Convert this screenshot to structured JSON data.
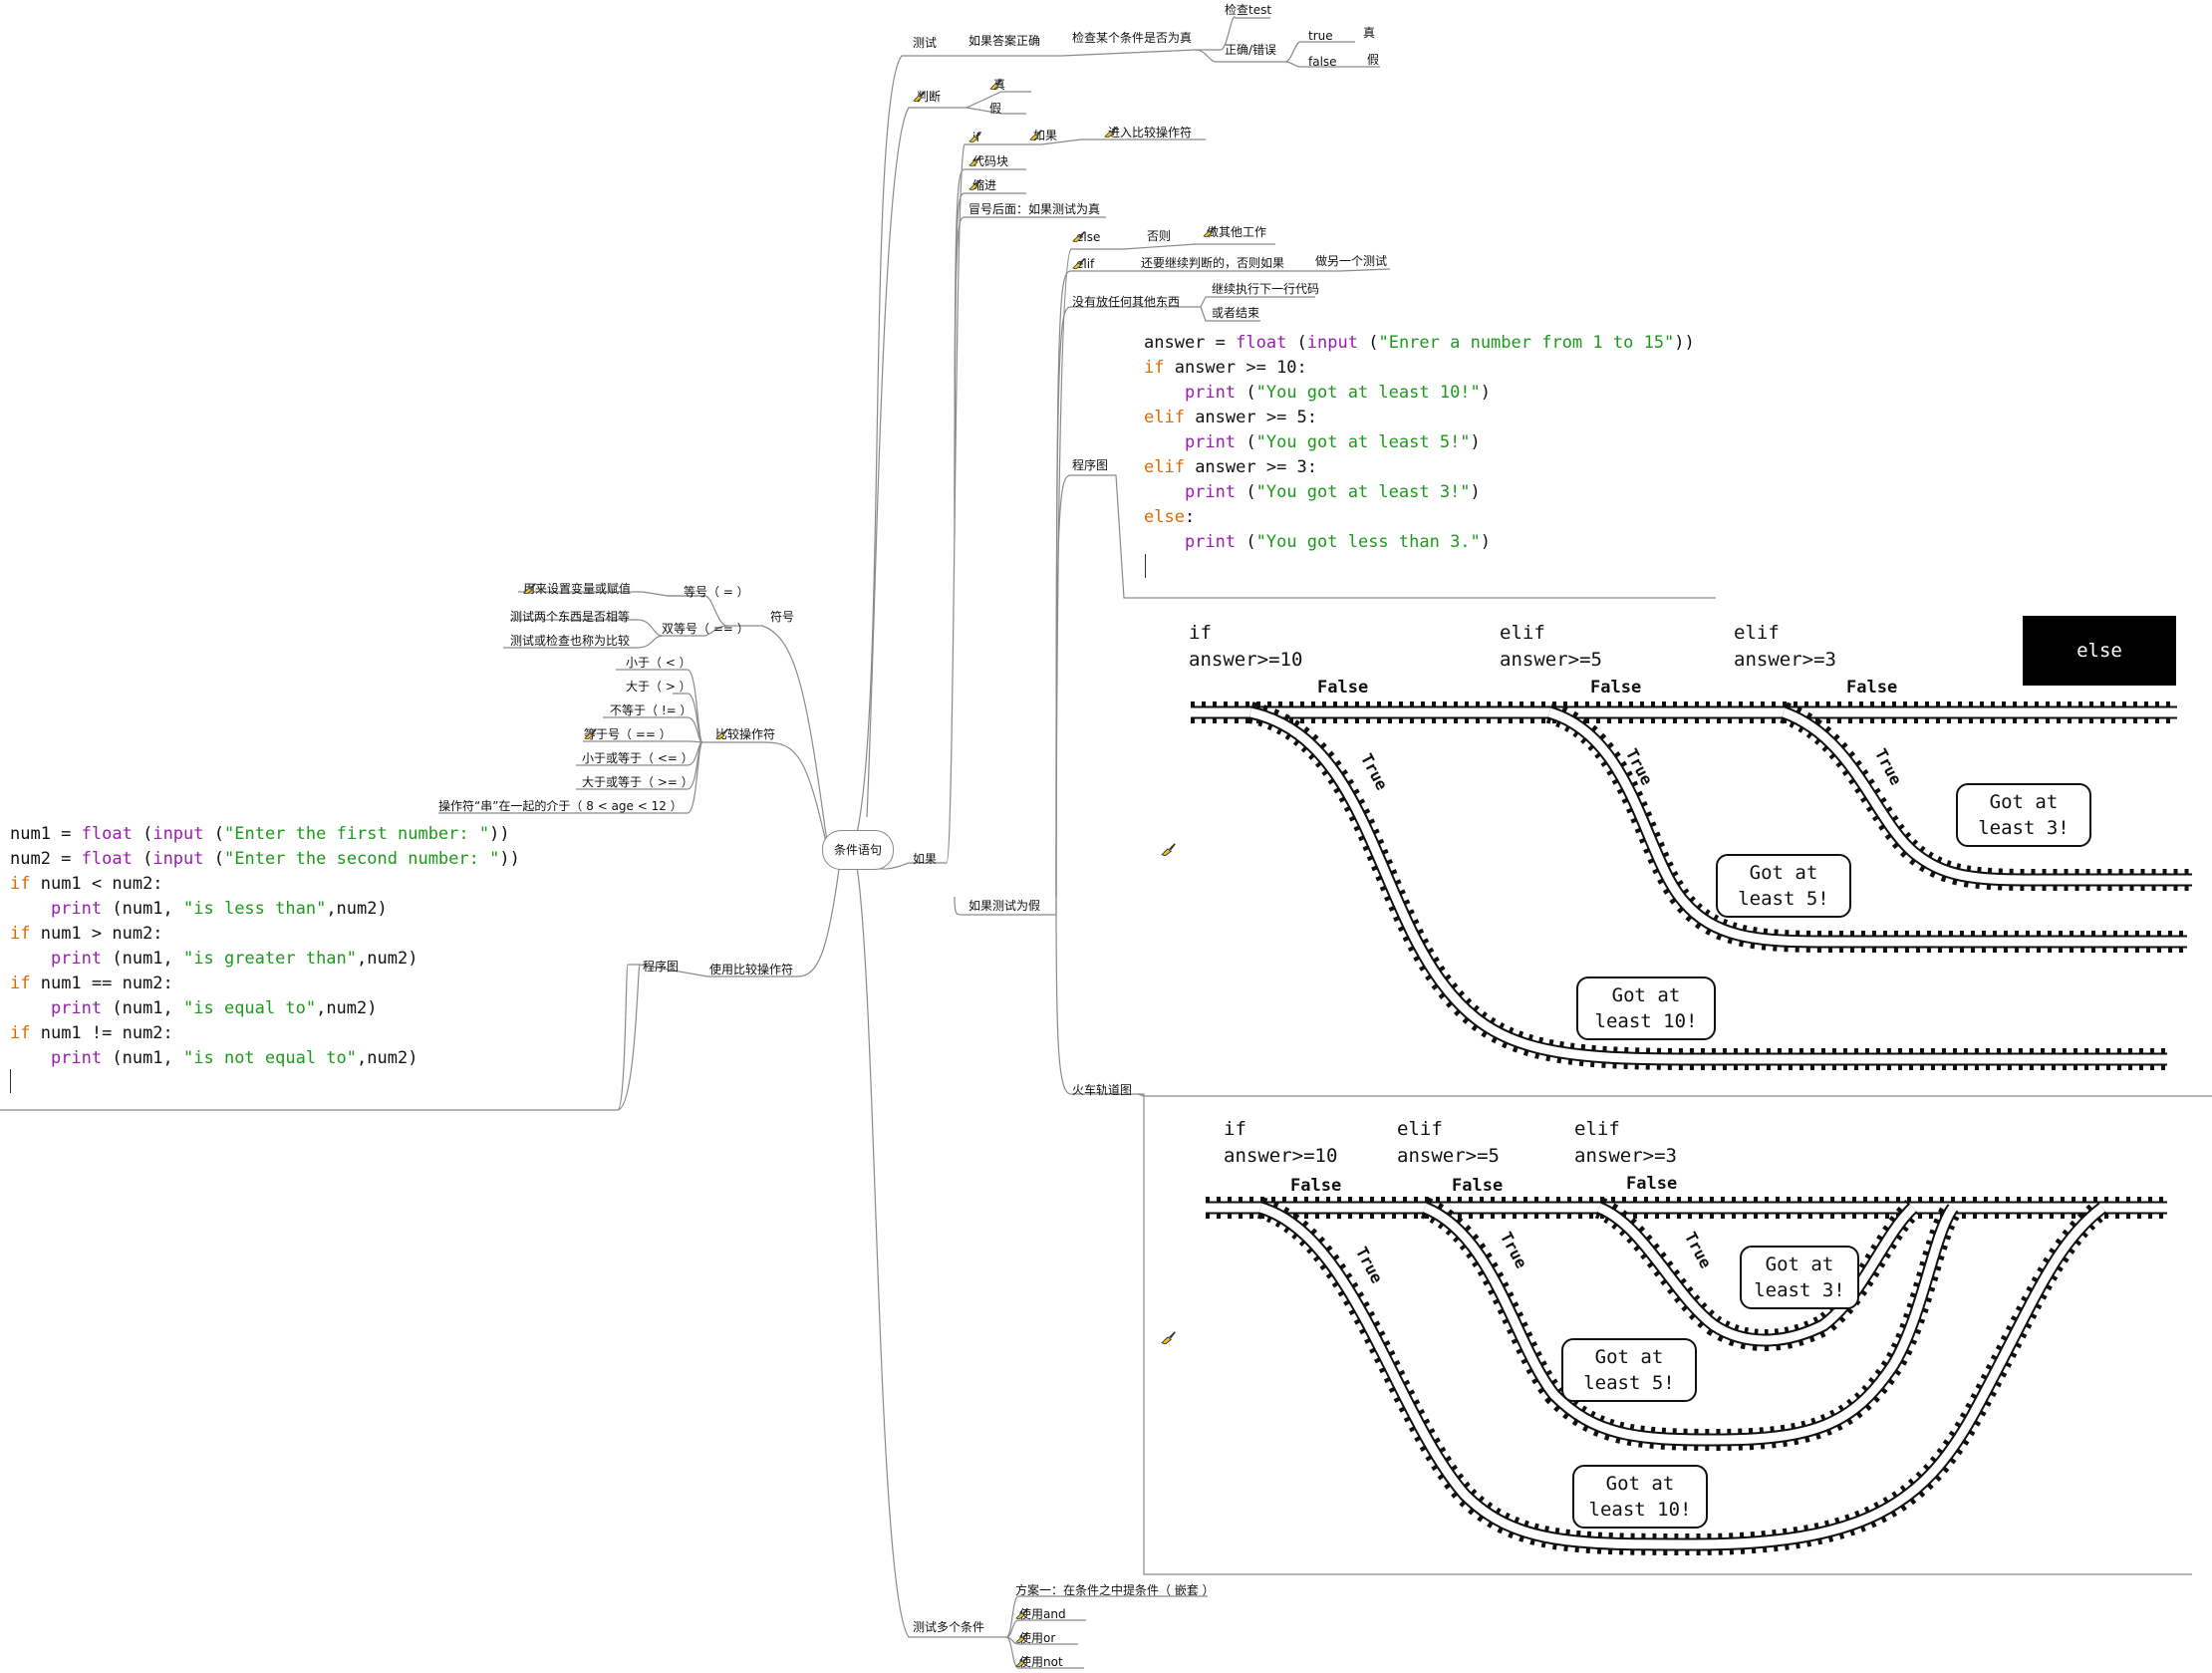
{
  "root": "条件语句",
  "test_branch": {
    "label": "测试",
    "if_correct": "如果答案正确",
    "check_condition": "检查某个条件是否为真",
    "check_test": "检查test",
    "correct_wrong": "正确/错误",
    "true_label": "true",
    "true_value": "真",
    "false_label": "false",
    "false_value": "假"
  },
  "judge_branch": {
    "label": "判断",
    "true": "真",
    "false": "假"
  },
  "if_branch": {
    "label": "如果",
    "if_kw": "if",
    "if_meaning": "如果",
    "enter_compare": "进入比较操作符",
    "code_block": "代码块",
    "indent": "缩进",
    "after_colon": "冒号后面：如果测试为真",
    "if_false": "如果测试为假",
    "else_kw": "else",
    "else_meaning": "否则",
    "do_other": "做其他工作",
    "elif_kw": "elif",
    "elif_meaning": "还要继续判断的，否则如果",
    "do_another_test": "做另一个测试",
    "nothing_else": "没有放任何其他东西",
    "continue_next": "继续执行下一行代码",
    "or_end": "或者结束",
    "flow_chart": "程序图",
    "train_track": "火车轨道图"
  },
  "code_answer": [
    [
      {
        "t": "answer = ",
        "c": ""
      },
      {
        "t": "float",
        "c": "f"
      },
      {
        "t": " (",
        "c": ""
      },
      {
        "t": "input",
        "c": "f"
      },
      {
        "t": " (",
        "c": ""
      },
      {
        "t": "\"Enrer a number from 1 to 15\"",
        "c": "s"
      },
      {
        "t": "))",
        "c": ""
      }
    ],
    [
      {
        "t": "if",
        "c": "k"
      },
      {
        "t": " answer >= 10:",
        "c": ""
      }
    ],
    [
      {
        "t": "    print",
        "c": "f"
      },
      {
        "t": " (",
        "c": ""
      },
      {
        "t": "\"You got at least 10!\"",
        "c": "s"
      },
      {
        "t": ")",
        "c": ""
      }
    ],
    [
      {
        "t": "elif",
        "c": "k"
      },
      {
        "t": " answer >= 5:",
        "c": ""
      }
    ],
    [
      {
        "t": "    print",
        "c": "f"
      },
      {
        "t": " (",
        "c": ""
      },
      {
        "t": "\"You got at least 5!\"",
        "c": "s"
      },
      {
        "t": ")",
        "c": ""
      }
    ],
    [
      {
        "t": "elif",
        "c": "k"
      },
      {
        "t": " answer >= 3:",
        "c": ""
      }
    ],
    [
      {
        "t": "    print",
        "c": "f"
      },
      {
        "t": " (",
        "c": ""
      },
      {
        "t": "\"You got at least 3!\"",
        "c": "s"
      },
      {
        "t": ")",
        "c": ""
      }
    ],
    [
      {
        "t": "else",
        "c": "k"
      },
      {
        "t": ":",
        "c": ""
      }
    ],
    [
      {
        "t": "    print",
        "c": "f"
      },
      {
        "t": " (",
        "c": ""
      },
      {
        "t": "\"You got less than 3.\"",
        "c": "s"
      },
      {
        "t": ")",
        "c": ""
      }
    ]
  ],
  "code_compare": [
    [
      {
        "t": "num1 = ",
        "c": ""
      },
      {
        "t": "float",
        "c": "f"
      },
      {
        "t": " (",
        "c": ""
      },
      {
        "t": "input",
        "c": "f"
      },
      {
        "t": " (",
        "c": ""
      },
      {
        "t": "\"Enter the first number: \"",
        "c": "s"
      },
      {
        "t": "))",
        "c": ""
      }
    ],
    [
      {
        "t": "num2 = ",
        "c": ""
      },
      {
        "t": "float",
        "c": "f"
      },
      {
        "t": " (",
        "c": ""
      },
      {
        "t": "input",
        "c": "f"
      },
      {
        "t": " (",
        "c": ""
      },
      {
        "t": "\"Enter the second number: \"",
        "c": "s"
      },
      {
        "t": "))",
        "c": ""
      }
    ],
    [
      {
        "t": "if",
        "c": "k"
      },
      {
        "t": " num1 < num2:",
        "c": ""
      }
    ],
    [
      {
        "t": "    print",
        "c": "f"
      },
      {
        "t": " (num1, ",
        "c": ""
      },
      {
        "t": "\"is less than\"",
        "c": "s"
      },
      {
        "t": ",num2)",
        "c": ""
      }
    ],
    [
      {
        "t": "if",
        "c": "k"
      },
      {
        "t": " num1 > num2:",
        "c": ""
      }
    ],
    [
      {
        "t": "    print",
        "c": "f"
      },
      {
        "t": " (num1, ",
        "c": ""
      },
      {
        "t": "\"is greater than\"",
        "c": "s"
      },
      {
        "t": ",num2)",
        "c": ""
      }
    ],
    [
      {
        "t": "if",
        "c": "k"
      },
      {
        "t": " num1 == num2:",
        "c": ""
      }
    ],
    [
      {
        "t": "    print",
        "c": "f"
      },
      {
        "t": " (num1, ",
        "c": ""
      },
      {
        "t": "\"is equal to\"",
        "c": "s"
      },
      {
        "t": ",num2)",
        "c": ""
      }
    ],
    [
      {
        "t": "if",
        "c": "k"
      },
      {
        "t": " num1 != num2:",
        "c": ""
      }
    ],
    [
      {
        "t": "    print",
        "c": "f"
      },
      {
        "t": " (num1, ",
        "c": ""
      },
      {
        "t": "\"is not equal to\"",
        "c": "s"
      },
      {
        "t": ",num2)",
        "c": ""
      }
    ]
  ],
  "symbol_branch": {
    "label": "符号",
    "equals": "等号（ = ）",
    "equals_desc": "用来设置变量或赋值",
    "double_equals": "双等号（ == ）",
    "double_equals_desc1": "测试两个东西是否相等",
    "double_equals_desc2": "测试或检查也称为比较"
  },
  "compare_branch": {
    "label": "比较操作符",
    "items": [
      "小于（ < ）",
      "大于（ > ）",
      "不等于（ != ）",
      "等于号（ == ）",
      "小于或等于（ <= ）",
      "大于或等于（ >= ）",
      "操作符“串”在一起的介于（ 8 < age < 12 ）"
    ]
  },
  "use_compare_branch": {
    "label": "使用比较操作符",
    "flow_chart": "程序图"
  },
  "multi_branch": {
    "label": "测试多个条件",
    "items": [
      "方案一：在条件之中提条件（ 嵌套 ）",
      "使用and",
      "使用or",
      "使用not"
    ]
  },
  "track1": {
    "headers": [
      "if\nanswer>=10",
      "elif\nanswer>=5",
      "elif\nanswer>=3"
    ],
    "else_box": "else",
    "false_label": "False",
    "true_label": "True",
    "bubbles": [
      "Got at\nleast 3!",
      "Got at\nleast 5!",
      "Got at\nleast 10!"
    ]
  },
  "track2": {
    "headers": [
      "if\nanswer>=10",
      "elif\nanswer>=5",
      "elif\nanswer>=3"
    ],
    "false_label": "False",
    "true_label": "True",
    "bubbles": [
      "Got at\nleast 3!",
      "Got at\nleast 5!",
      "Got at\nleast 10!"
    ]
  },
  "colors": {
    "brush": "#f0c419",
    "line": "#777777"
  }
}
